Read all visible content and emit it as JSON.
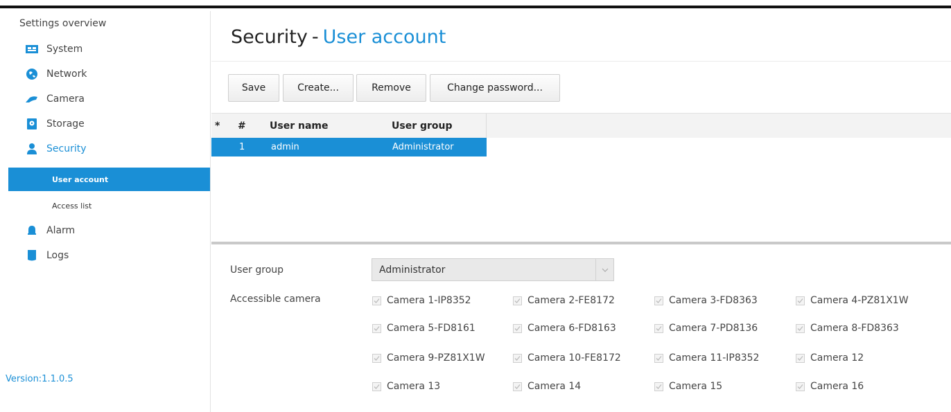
{
  "sidebar": {
    "title": "Settings overview",
    "items": [
      {
        "label": "System"
      },
      {
        "label": "Network"
      },
      {
        "label": "Camera"
      },
      {
        "label": "Storage"
      },
      {
        "label": "Security"
      },
      {
        "label": "Alarm"
      },
      {
        "label": "Logs"
      }
    ],
    "security_sub": [
      {
        "label": "User account"
      },
      {
        "label": "Access list"
      }
    ],
    "version": "Version:1.1.0.5"
  },
  "header": {
    "title": "Security",
    "separator": "-",
    "subtitle": "User account"
  },
  "toolbar": {
    "save_label": "Save",
    "create_label": "Create...",
    "remove_label": "Remove",
    "change_password_label": "Change password..."
  },
  "table": {
    "columns": [
      "*",
      "#",
      "User name",
      "User group"
    ],
    "rows": [
      {
        "index": "1",
        "user_name": "admin",
        "user_group": "Administrator"
      }
    ]
  },
  "form": {
    "user_group_label": "User group",
    "user_group_value": "Administrator",
    "accessible_camera_label": "Accessible camera",
    "cameras": [
      "Camera 1-IP8352",
      "Camera 2-FE8172",
      "Camera 3-FD8363",
      "Camera 4-PZ81X1W",
      "Camera 5-FD8161",
      "Camera 6-FD8163",
      "Camera 7-PD8136",
      "Camera 8-FD8363",
      "Camera 9-PZ81X1W",
      "Camera 10-FE8172",
      "Camera 11-IP8352",
      "Camera 12",
      "Camera 13",
      "Camera 14",
      "Camera 15",
      "Camera 16"
    ]
  },
  "colors": {
    "accent": "#1a8fd6",
    "selection": "#1a8fd6"
  }
}
